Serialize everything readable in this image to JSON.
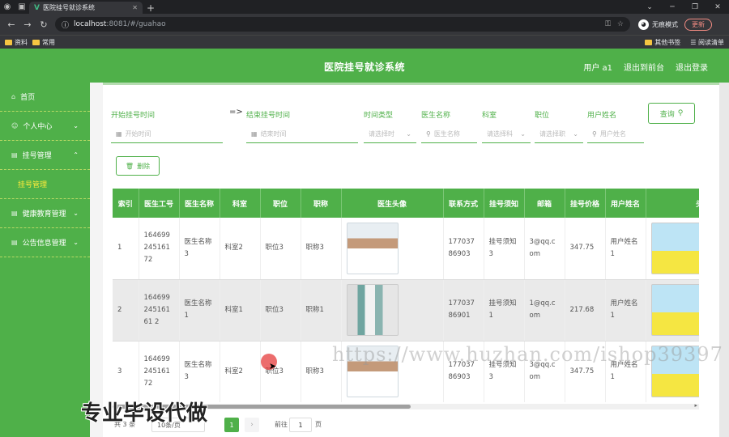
{
  "browser": {
    "tab_title": "医院挂号就诊系统",
    "url_host": "localhost",
    "url_rest": ":8081/#/guahao",
    "incognito_label": "无痕模式",
    "update_label": "更新",
    "bookmarks": [
      "资料",
      "常用"
    ],
    "bookmarks_right": [
      "其他书签",
      "阅读清单"
    ]
  },
  "header": {
    "title": "医院挂号就诊系统",
    "user": "用户 a1",
    "back_to_front": "退出到前台",
    "logout": "退出登录"
  },
  "sidebar": {
    "items": [
      {
        "label": "首页"
      },
      {
        "label": "个人中心"
      },
      {
        "label": "挂号管理"
      },
      {
        "label": "挂号管理"
      },
      {
        "label": "健康教育管理"
      },
      {
        "label": "公告信息管理"
      }
    ]
  },
  "filters": {
    "start_label": "开始挂号时间",
    "start_placeholder": "开始时间",
    "end_label": "结束挂号时间",
    "end_placeholder": "结束时间",
    "time_type_label": "时间类型",
    "time_type_placeholder": "请选择时",
    "doctor_name_label": "医生名称",
    "doctor_name_placeholder": "医生名称",
    "dept_label": "科室",
    "dept_placeholder": "请选择科",
    "post_label": "职位",
    "post_placeholder": "请选择职",
    "username_label": "用户姓名",
    "username_placeholder": "用户姓名",
    "query_label": "查询",
    "delete_label": "删除"
  },
  "table": {
    "columns": [
      "索引",
      "医生工号",
      "医生名称",
      "科室",
      "职位",
      "职称",
      "医生头像",
      "联系方式",
      "挂号须知",
      "邮箱",
      "挂号价格",
      "用户姓名",
      "头像"
    ],
    "rows": [
      {
        "idx": "1",
        "no": "16469924516172",
        "name": "医生名称3",
        "dept": "科室2",
        "post": "职位3",
        "title": "职称3",
        "phone": "17703786903",
        "notice": "挂号须知3",
        "email": "3@qq.com",
        "price": "347.75",
        "user": "用户姓名1"
      },
      {
        "idx": "2",
        "no": "16469924516161 2",
        "name": "医生名称1",
        "dept": "科室1",
        "post": "职位3",
        "title": "职称1",
        "phone": "17703786901",
        "notice": "挂号须知1",
        "email": "1@qq.com",
        "price": "217.68",
        "user": "用户姓名1"
      },
      {
        "idx": "3",
        "no": "16469924516172",
        "name": "医生名称3",
        "dept": "科室2",
        "post": "职位3",
        "title": "职称3",
        "phone": "17703786903",
        "notice": "挂号须知3",
        "email": "3@qq.com",
        "price": "347.75",
        "user": "用户姓名1"
      }
    ]
  },
  "pagination": {
    "total_label": "共 3 条",
    "page_size": "10条/页",
    "current_page": "1",
    "goto_label": "前往",
    "goto_value": "1",
    "page_unit": "页"
  },
  "watermark": {
    "url": "https://www.huzhan.com/ishop39397",
    "slogan": "专业毕设代做"
  }
}
